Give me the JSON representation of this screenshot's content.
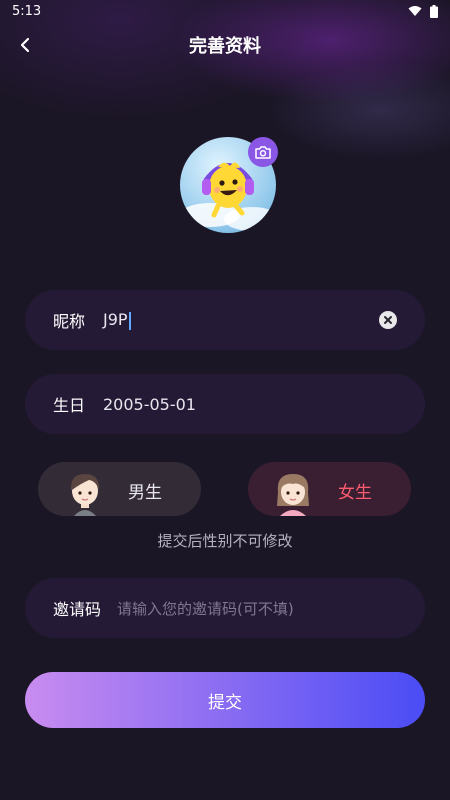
{
  "status_bar": {
    "time": "5:13"
  },
  "header": {
    "title": "完善资料"
  },
  "form": {
    "nickname": {
      "label": "昵称",
      "value": "J9P"
    },
    "birthday": {
      "label": "生日",
      "value": "2005-05-01"
    },
    "gender": {
      "male_label": "男生",
      "female_label": "女生",
      "selected": "female",
      "note": "提交后性别不可修改"
    },
    "invite": {
      "label": "邀请码",
      "placeholder": "请输入您的邀请码(可不填)"
    },
    "submit_label": "提交"
  },
  "colors": {
    "background": "#1b1626",
    "field_bg": "#241a36",
    "accent_female": "#ff5b6e",
    "submit_gradient_start": "#c98cf0",
    "submit_gradient_end": "#4a4cf5"
  }
}
